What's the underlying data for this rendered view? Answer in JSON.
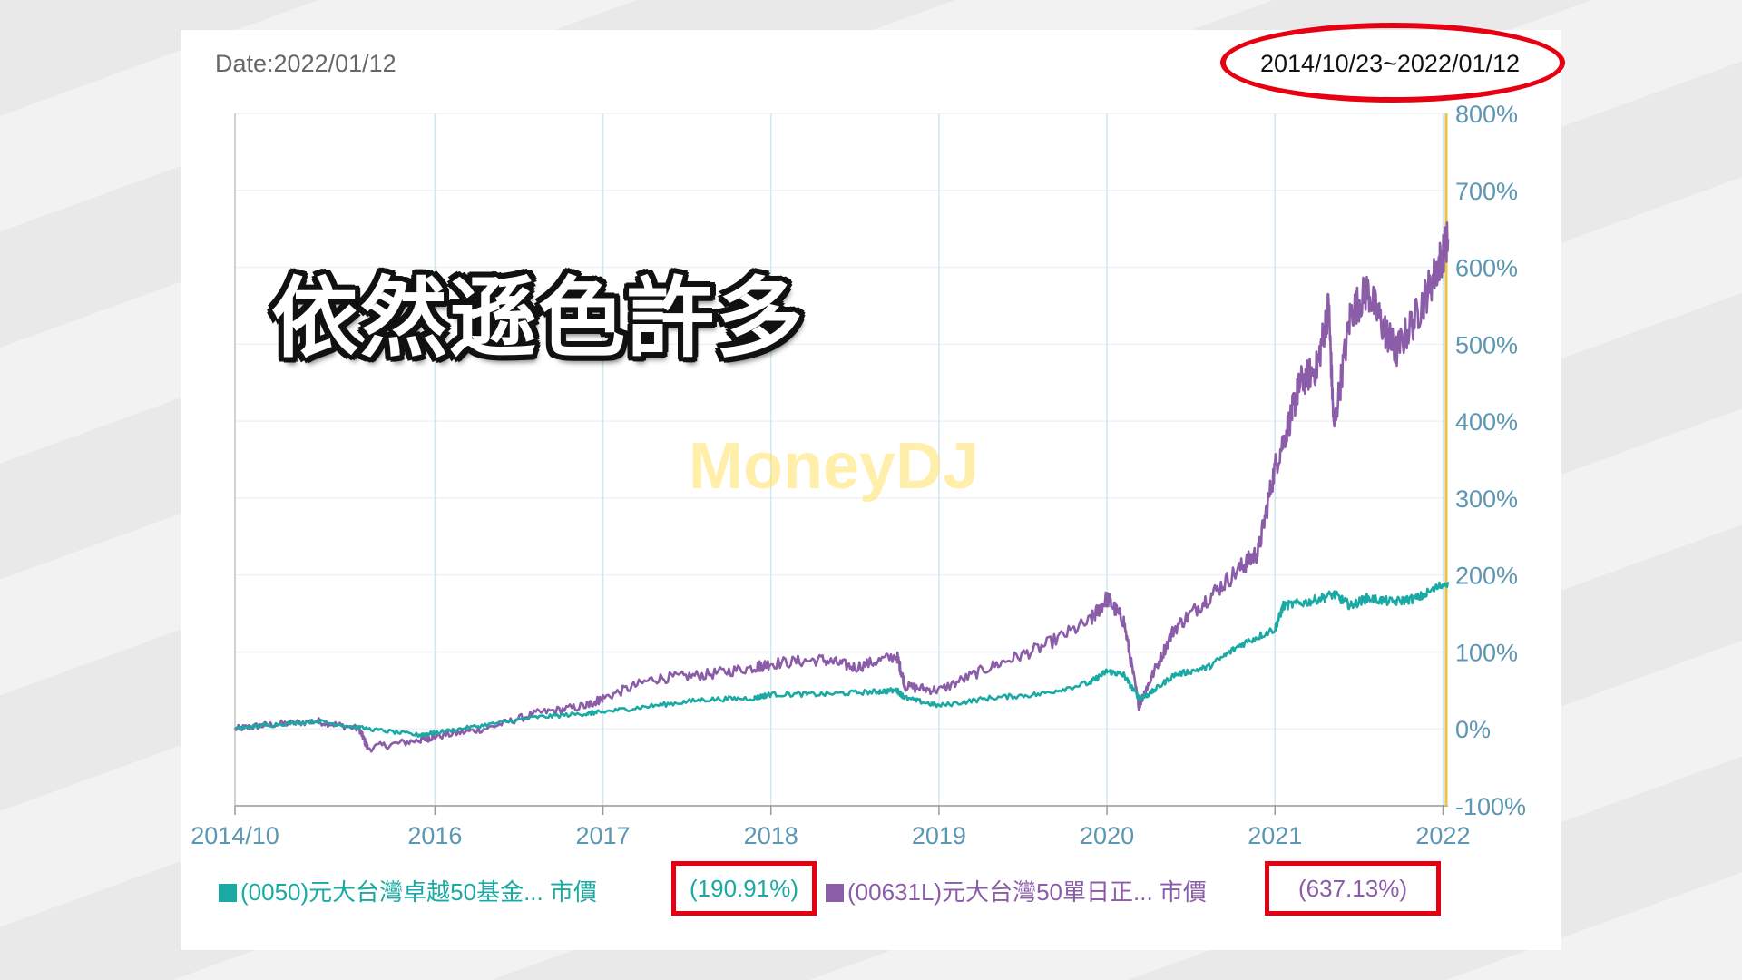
{
  "header": {
    "date_label": "Date:2022/01/12",
    "range_label": "2014/10/23~2022/01/12"
  },
  "overlay": {
    "caption": "依然遜色許多",
    "watermark": "MoneyDJ"
  },
  "legend": {
    "series_a_label": "(0050)元大台灣卓越50基金... 市價",
    "series_a_return": "(190.91%)",
    "series_b_label": "(00631L)元大台灣50單日正... 市價",
    "series_b_return": "(637.13%)"
  },
  "colors": {
    "series_a": "#1aaaa3",
    "series_b": "#8b5ca8",
    "highlight": "#e60012",
    "axis_text": "#5b97b3",
    "cursor_line": "#e8c547"
  },
  "chart_data": {
    "type": "line",
    "xlabel": "",
    "ylabel": "",
    "x_ticks": [
      "2014/10",
      "2016",
      "2017",
      "2018",
      "2019",
      "2020",
      "2021",
      "2022"
    ],
    "x_tick_values": [
      2014.81,
      2016.0,
      2017.0,
      2018.0,
      2019.0,
      2020.0,
      2021.0,
      2022.0
    ],
    "xlim": [
      2014.81,
      2022.03
    ],
    "y_ticks": [
      "800%",
      "700%",
      "600%",
      "500%",
      "400%",
      "300%",
      "200%",
      "100%",
      "0%",
      "-100%"
    ],
    "y_tick_values": [
      800,
      700,
      600,
      500,
      400,
      300,
      200,
      100,
      0,
      -100
    ],
    "ylim": [
      -100,
      800
    ],
    "y_axis_side": "right",
    "grid": true,
    "legend_position": "bottom",
    "series": [
      {
        "name": "(0050)元大台灣卓越50基金... 市價",
        "final_return_pct": 190.91,
        "x": [
          2014.81,
          2015.0,
          2015.3,
          2015.6,
          2015.9,
          2016.0,
          2016.3,
          2016.6,
          2016.9,
          2017.0,
          2017.3,
          2017.6,
          2017.9,
          2018.0,
          2018.3,
          2018.6,
          2018.75,
          2018.8,
          2019.0,
          2019.3,
          2019.6,
          2019.9,
          2020.0,
          2020.1,
          2020.19,
          2020.25,
          2020.4,
          2020.6,
          2020.8,
          2021.0,
          2021.05,
          2021.2,
          2021.35,
          2021.45,
          2021.55,
          2021.7,
          2021.85,
          2022.03
        ],
        "y": [
          0,
          5,
          10,
          0,
          -8,
          -5,
          5,
          15,
          20,
          22,
          30,
          38,
          40,
          45,
          45,
          48,
          50,
          40,
          30,
          40,
          45,
          60,
          75,
          70,
          40,
          45,
          70,
          80,
          110,
          130,
          160,
          165,
          175,
          160,
          170,
          165,
          170,
          191
        ]
      },
      {
        "name": "(00631L)元大台灣50單日正... 市價",
        "final_return_pct": 637.13,
        "x": [
          2014.81,
          2015.0,
          2015.3,
          2015.55,
          2015.6,
          2015.9,
          2016.0,
          2016.3,
          2016.6,
          2016.9,
          2017.0,
          2017.3,
          2017.6,
          2017.9,
          2018.0,
          2018.3,
          2018.5,
          2018.75,
          2018.8,
          2019.0,
          2019.3,
          2019.6,
          2019.9,
          2020.0,
          2020.1,
          2020.19,
          2020.25,
          2020.4,
          2020.6,
          2020.8,
          2020.9,
          2021.0,
          2021.1,
          2021.15,
          2021.25,
          2021.32,
          2021.35,
          2021.45,
          2021.55,
          2021.65,
          2021.72,
          2021.85,
          2021.95,
          2022.03
        ],
        "y": [
          0,
          5,
          10,
          0,
          -25,
          -15,
          -10,
          0,
          20,
          30,
          40,
          65,
          70,
          80,
          85,
          90,
          80,
          95,
          55,
          50,
          80,
          105,
          140,
          170,
          140,
          30,
          60,
          130,
          170,
          210,
          230,
          340,
          410,
          450,
          470,
          550,
          390,
          540,
          570,
          520,
          490,
          540,
          590,
          637
        ]
      }
    ]
  }
}
